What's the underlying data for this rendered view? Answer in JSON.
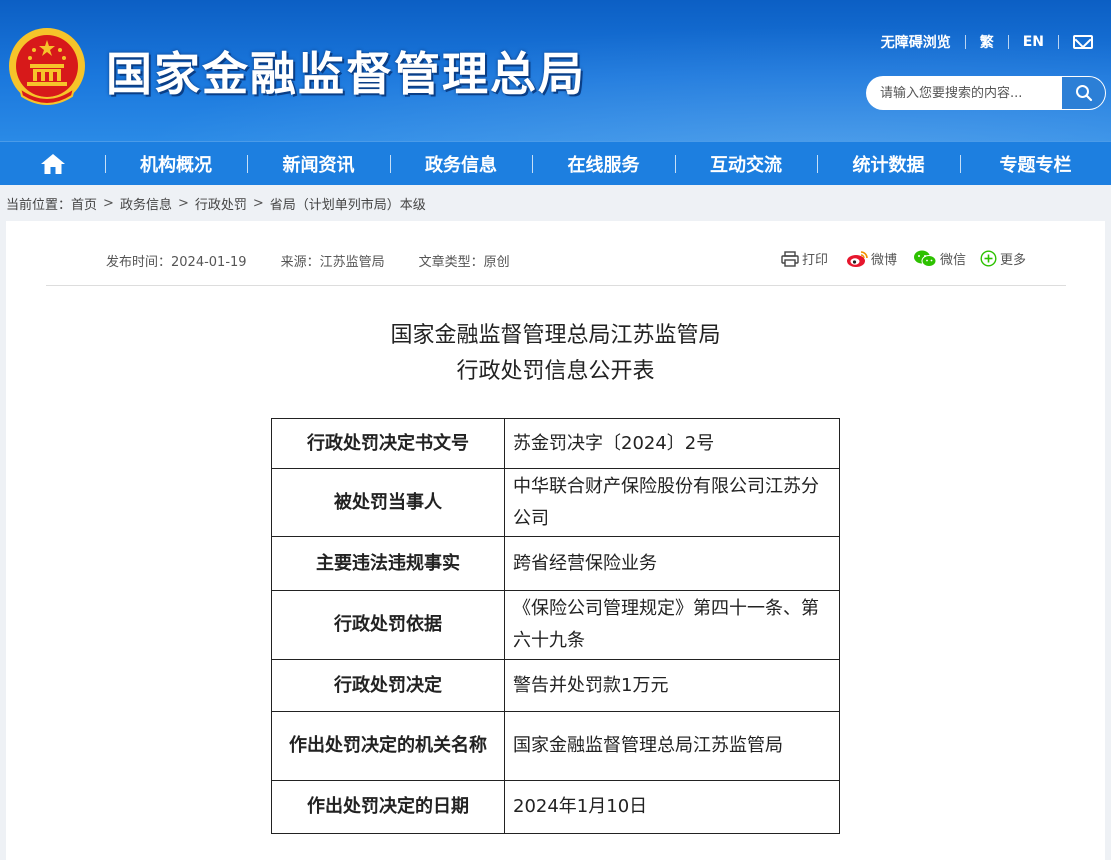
{
  "header": {
    "site_title": "国家金融监督管理总局",
    "accessibility_link": "无障碍浏览",
    "traditional_link": "繁",
    "english_link": "EN",
    "search_placeholder": "请输入您要搜索的内容..."
  },
  "nav": {
    "items": [
      "机构概况",
      "新闻资讯",
      "政务信息",
      "在线服务",
      "互动交流",
      "统计数据",
      "专题专栏"
    ]
  },
  "breadcrumb": {
    "label": "当前位置：",
    "items": [
      "首页",
      "政务信息",
      "行政处罚",
      "省局（计划单列市局）本级"
    ]
  },
  "article": {
    "publish_time": "发布时间：2024-01-19",
    "source": "来源：江苏监管局",
    "type": "文章类型：原创",
    "share": {
      "print": "打印",
      "weibo": "微博",
      "wechat": "微信",
      "more": "更多"
    },
    "title_line1": "国家金融监督管理总局江苏监管局",
    "title_line2": "行政处罚信息公开表"
  },
  "table": {
    "rows": [
      {
        "key": "行政处罚决定书文号",
        "value": "苏金罚决字〔2024〕2号"
      },
      {
        "key": "被处罚当事人",
        "value": "中华联合财产保险股份有限公司江苏分公司"
      },
      {
        "key": "主要违法违规事实",
        "value": "跨省经营保险业务"
      },
      {
        "key": "行政处罚依据",
        "value": "《保险公司管理规定》第四十一条、第六十九条"
      },
      {
        "key": "行政处罚决定",
        "value": "警告并处罚款1万元"
      },
      {
        "key": "作出处罚决定的机关名称",
        "value": "国家金融监督管理总局江苏监管局"
      },
      {
        "key": "作出处罚决定的日期",
        "value": "2024年1月10日"
      }
    ]
  },
  "colors": {
    "header_blue": "#1b78dd",
    "nav_blue": "#1d7fe0",
    "emblem_red": "#d7191a",
    "emblem_gold": "#f6c42a"
  }
}
